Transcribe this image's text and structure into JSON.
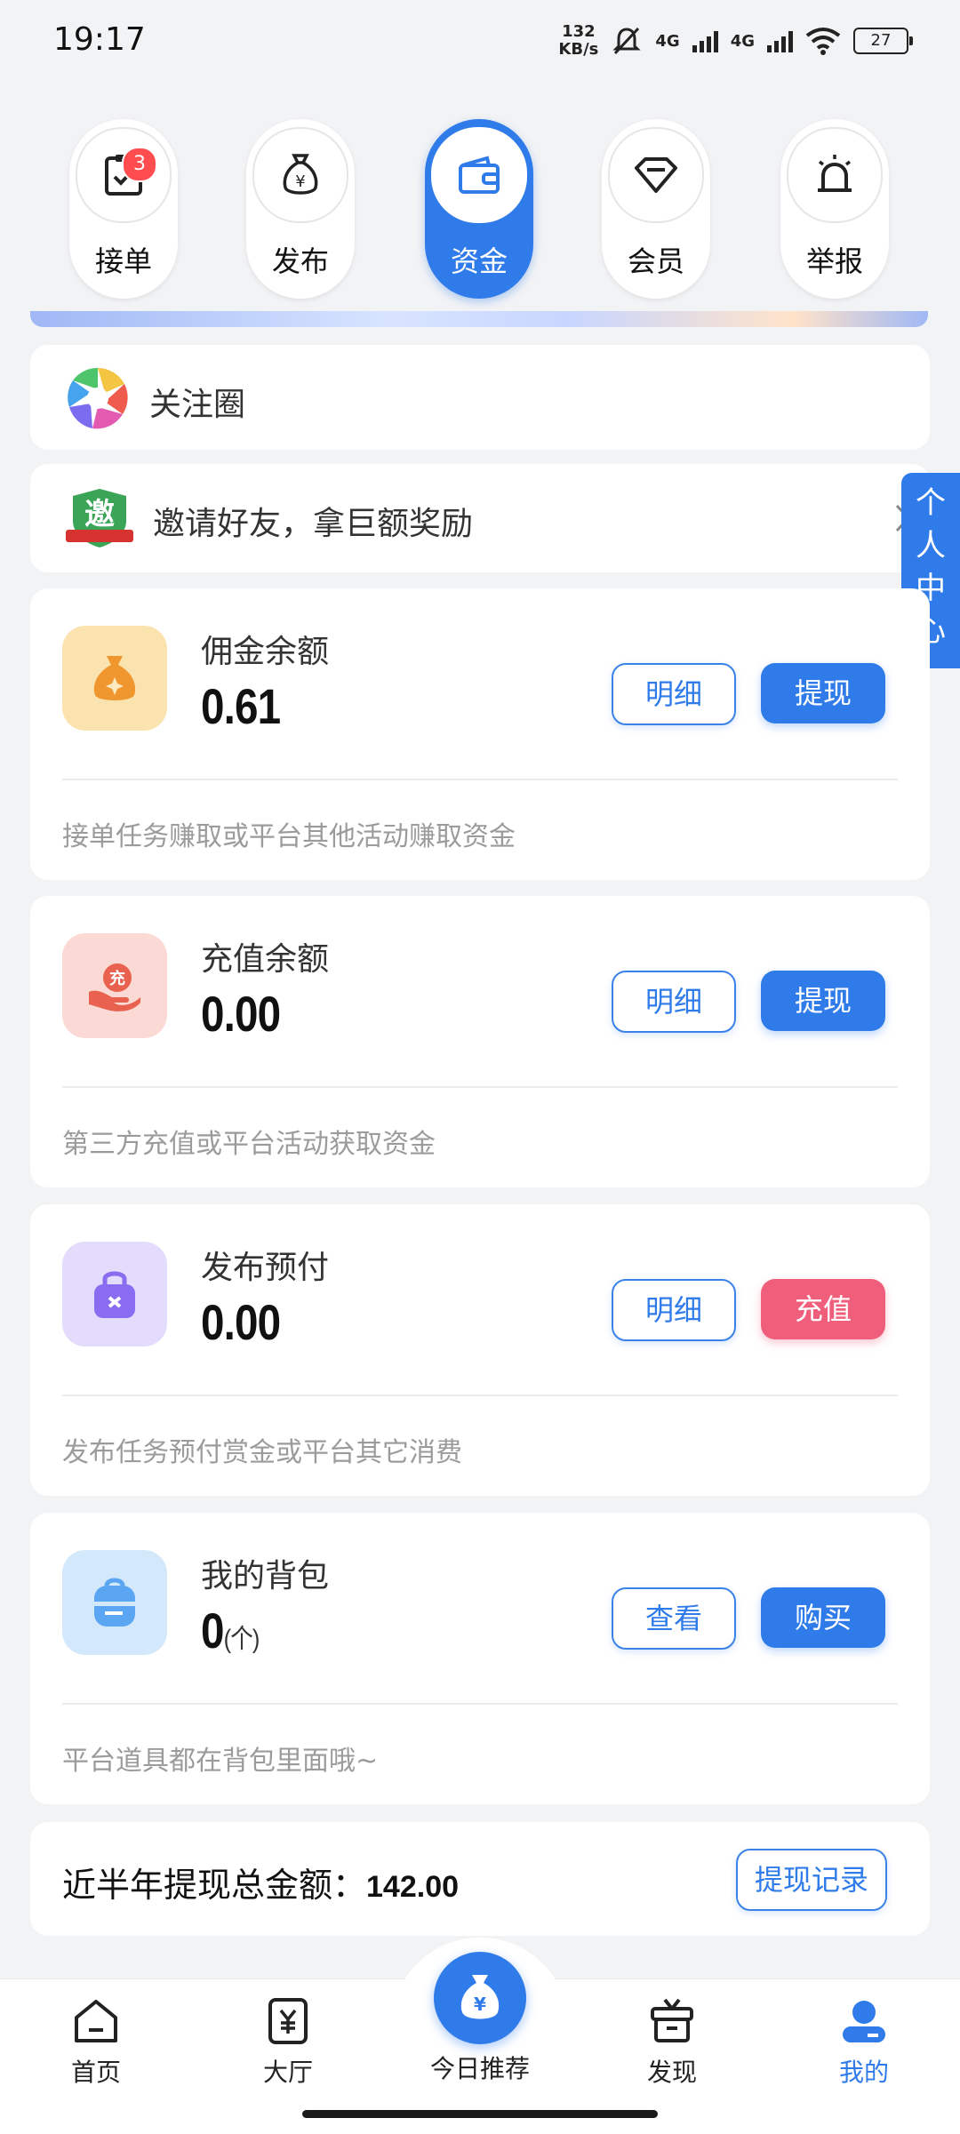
{
  "status_bar": {
    "time": "19:17",
    "net_speed_value": "132",
    "net_speed_unit": "KB/s",
    "sig1": "4G",
    "sig2": "4G",
    "battery": "27"
  },
  "top_tabs": [
    {
      "label": "接单",
      "icon": "clipboard-check-icon",
      "badge": "3"
    },
    {
      "label": "发布",
      "icon": "money-bag-icon"
    },
    {
      "label": "资金",
      "icon": "wallet-icon",
      "active": true
    },
    {
      "label": "会员",
      "icon": "diamond-icon"
    },
    {
      "label": "举报",
      "icon": "alarm-icon"
    }
  ],
  "follow_circle": {
    "label": "关注圈",
    "icon": "aperture-icon"
  },
  "invite": {
    "label": "邀请好友，拿巨额奖励",
    "badge_char": "邀"
  },
  "side_tab": {
    "label": "个人中心"
  },
  "funds": [
    {
      "title": "佣金余额",
      "amount": "0.61",
      "btn1": "明细",
      "btn2": "提现",
      "desc": "接单任务赚取或平台其他活动赚取资金",
      "accent": "#f3b94c"
    },
    {
      "title": "充值余额",
      "amount": "0.00",
      "btn1": "明细",
      "btn2": "提现",
      "desc": "第三方充值或平台活动获取资金",
      "accent": "#ec6b5d"
    },
    {
      "title": "发布预付",
      "amount": "0.00",
      "btn1": "明细",
      "btn2": "充值",
      "desc": "发布任务预付赏金或平台其它消费",
      "accent": "#8a6cf0"
    },
    {
      "title": "我的背包",
      "amount": "0",
      "unit": "(个)",
      "btn1": "查看",
      "btn2": "购买",
      "desc": "平台道具都在背包里面哦~",
      "accent": "#5aa6f2"
    }
  ],
  "total": {
    "label": "近半年提现总金额：",
    "value": "142.00",
    "button": "提现记录"
  },
  "bottom_nav": [
    {
      "label": "首页",
      "icon": "home-icon"
    },
    {
      "label": "大厅",
      "icon": "yen-tag-icon"
    },
    {
      "label": "今日推荐",
      "icon": "money-bag-icon",
      "center": true
    },
    {
      "label": "发现",
      "icon": "gift-box-icon"
    },
    {
      "label": "我的",
      "icon": "user-icon",
      "active": true
    }
  ],
  "colors": {
    "primary": "#2f7bea",
    "pink": "#ef5f7c",
    "background": "#f2f3f5"
  }
}
